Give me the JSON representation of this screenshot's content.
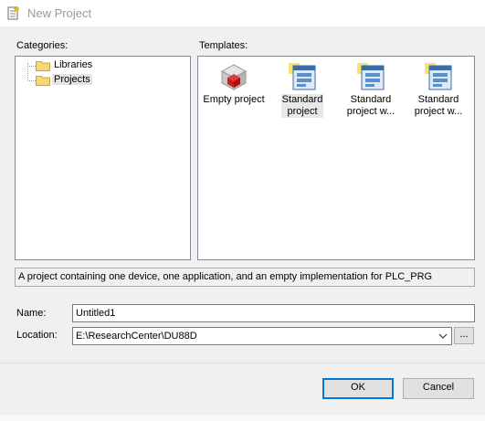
{
  "window": {
    "title": "New Project",
    "icon": "new-project-icon"
  },
  "categories": {
    "label": "Categories:",
    "items": [
      {
        "label": "Libraries",
        "icon": "folder-icon",
        "selected": false
      },
      {
        "label": "Projects",
        "icon": "folder-icon",
        "selected": true
      }
    ]
  },
  "templates": {
    "label": "Templates:",
    "items": [
      {
        "line1": "Empty project",
        "line2": "",
        "icon": "empty-project-icon"
      },
      {
        "line1": "Standard",
        "line2": "project",
        "icon": "standard-project-icon",
        "highlighted": true
      },
      {
        "line1": "Standard",
        "line2": "project w...",
        "icon": "standard-project-icon"
      },
      {
        "line1": "Standard",
        "line2": "project w...",
        "icon": "standard-project-icon"
      }
    ]
  },
  "description": "A project containing one device, one application, and an empty implementation for PLC_PRG",
  "form": {
    "name_label": "Name:",
    "name_value": "Untitled1",
    "location_label": "Location:",
    "location_value": "E:\\ResearchCenter\\DU88D",
    "browse_label": "..."
  },
  "buttons": {
    "ok": "OK",
    "cancel": "Cancel"
  },
  "colors": {
    "accent": "#0078d7",
    "dialog_bg": "#f0f0f0",
    "panel_border": "#828790"
  }
}
